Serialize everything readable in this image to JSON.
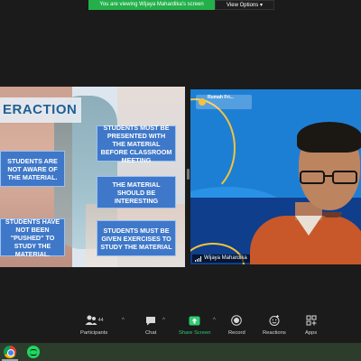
{
  "banner": {
    "viewing_text": "You are viewing Wijaya Mahardika's screen",
    "options_label": "View Options",
    "options_caret": "▾",
    "accent_color": "#23b04a"
  },
  "slide": {
    "title": "ERACTION",
    "boxes": [
      "STUDENTS ARE NOT AWARE OF THE MATERIAL.",
      "STUDENTS HAVE NOT BEEN \"PUSHED\" TO STUDY THE MATERIAL.",
      "STUDENTS MUST BE PRESENTED WITH THE MATERIAL BEFORE CLASSROOM MEETING",
      "THE MATERIAL SHOULD BE INTERESTING",
      "STUDENTS MUST BE GIVEN EXERCISES TO STUDY THE MATERIAL"
    ],
    "box_color": "#3f78c9"
  },
  "video": {
    "participant_name": "Wijaya Mahardika",
    "background_logo_text": "Rumah Fri..."
  },
  "toolbar": {
    "participants_label": "Participants",
    "participants_count": "44",
    "chat_label": "Chat",
    "share_label": "Share Screen",
    "record_label": "Record",
    "reactions_label": "Reactions",
    "apps_label": "Apps",
    "caret": "^",
    "share_color": "#2ecc71"
  },
  "taskbar": {
    "apps": [
      "chrome-icon",
      "spotify-icon"
    ]
  }
}
